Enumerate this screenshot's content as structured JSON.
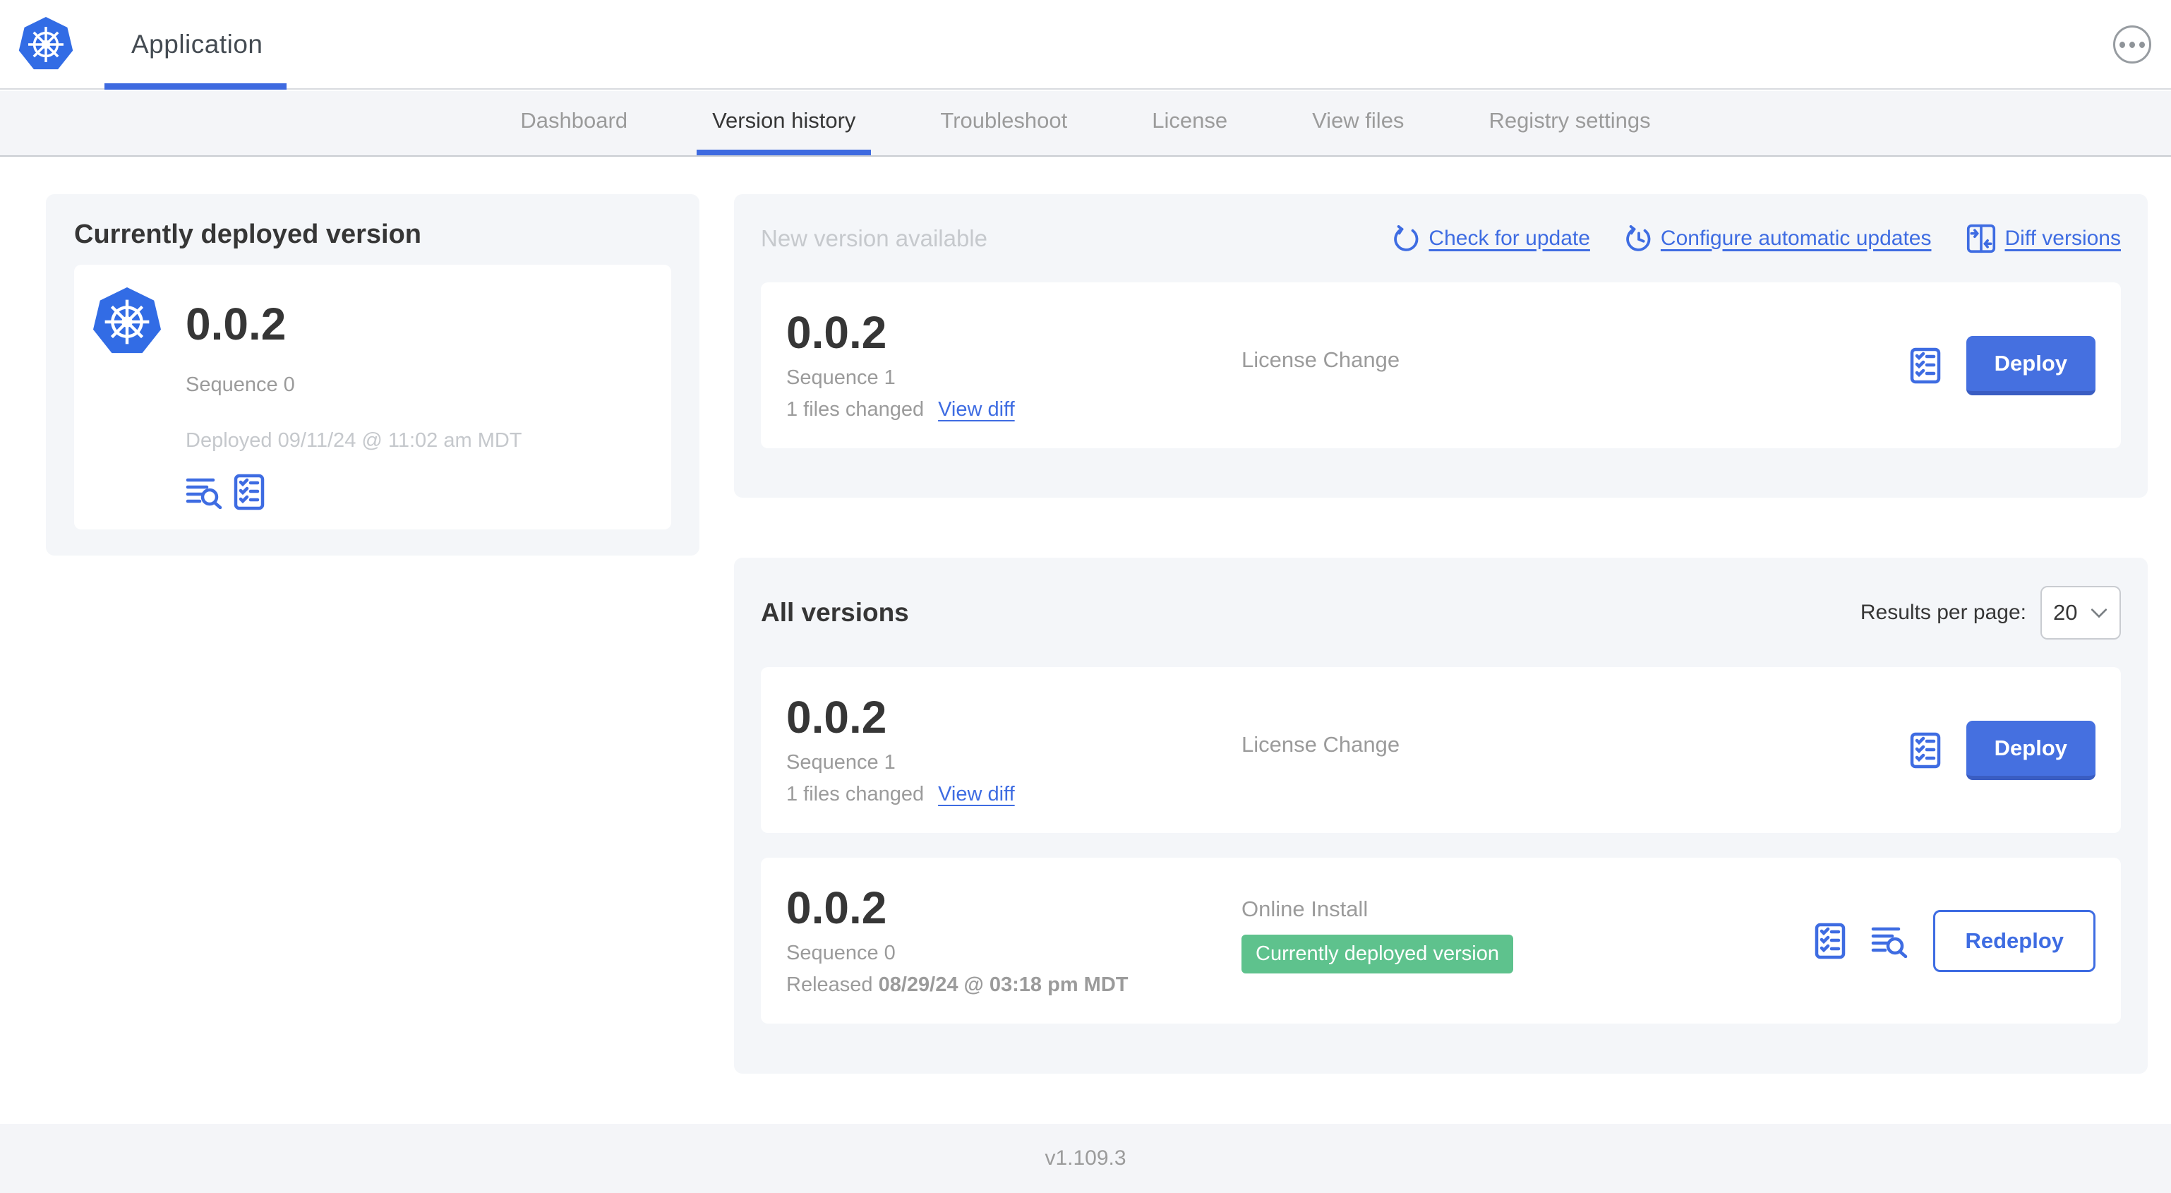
{
  "header": {
    "app_title": "Application"
  },
  "nav": {
    "tabs": [
      "Dashboard",
      "Version history",
      "Troubleshoot",
      "License",
      "View files",
      "Registry settings"
    ],
    "active_tab": "Version history"
  },
  "current_deployed": {
    "title": "Currently deployed version",
    "version": "0.0.2",
    "sequence": "Sequence 0",
    "deployed": "Deployed 09/11/24 @ 11:02 am MDT"
  },
  "new_version": {
    "title": "New version available",
    "actions": {
      "check": "Check for update",
      "configure": "Configure automatic updates",
      "diff": "Diff versions"
    },
    "card": {
      "version": "0.0.2",
      "sequence": "Sequence 1",
      "files_changed": "1 files changed",
      "view_diff": "View diff",
      "source": "License Change",
      "deploy_label": "Deploy"
    }
  },
  "all_versions": {
    "title": "All versions",
    "results_per_page_label": "Results per page:",
    "results_per_page_value": "20",
    "rows": [
      {
        "version": "0.0.2",
        "sequence": "Sequence 1",
        "files_changed": "1 files changed",
        "view_diff": "View diff",
        "source": "License Change",
        "action": "Deploy"
      },
      {
        "version": "0.0.2",
        "sequence": "Sequence 0",
        "released_prefix": "Released",
        "released_date": "08/29/24 @ 03:18 pm MDT",
        "source": "Online Install",
        "badge": "Currently deployed version",
        "action": "Redeploy"
      }
    ]
  },
  "footer": {
    "version": "v1.109.3"
  },
  "icons": {
    "app_logo": "kubernetes-wheel",
    "more": "ellipsis-circle",
    "logs": "lines-with-magnifier",
    "preflight": "checklist",
    "check_update": "refresh-arrow",
    "auto_update": "clock-refresh",
    "diff": "split-diff",
    "select": "chevron-down"
  },
  "colors": {
    "accent_blue": "#3e6ce2",
    "button_blue": "#4570e0",
    "badge_green": "#5ec28d",
    "logo_blue": "#326ce5",
    "panel_gray": "#f4f6f9"
  }
}
